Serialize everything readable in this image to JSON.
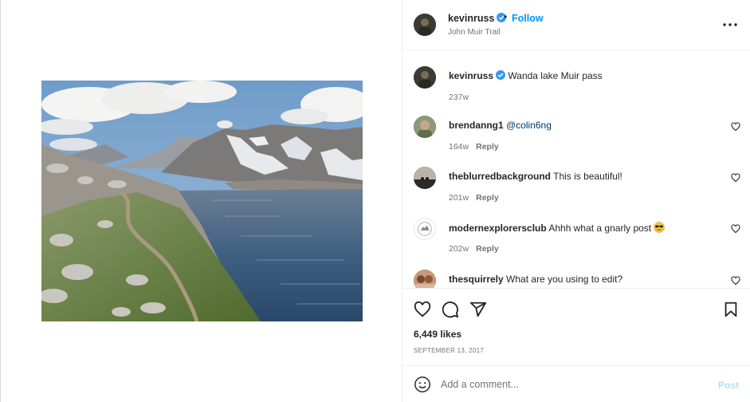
{
  "post": {
    "username": "kevinruss",
    "follow_label": "Follow",
    "separator": "•",
    "location": "John Muir Trail",
    "more_icon": "more-horizontal-icon"
  },
  "caption": {
    "username": "kevinruss",
    "text": "Wanda lake Muir pass",
    "age": "237w"
  },
  "comments": [
    {
      "username": "brendanng1",
      "text": "@colin6ng",
      "age": "164w",
      "reply_label": "Reply"
    },
    {
      "username": "theblurredbackground",
      "text": "This is beautiful!",
      "age": "201w",
      "reply_label": "Reply"
    },
    {
      "username": "modernexplorersclub",
      "text": "Ahhh what a gnarly post",
      "age": "202w",
      "reply_label": "Reply",
      "emoji": "sunglasses-emoji"
    },
    {
      "username": "thesquirrely",
      "text": "What are you using to edit?",
      "age": "",
      "reply_label": ""
    }
  ],
  "actions": {
    "likes": "6,449 likes",
    "date": "SEPTEMBER 13, 2017",
    "icons": [
      "heart-icon",
      "comment-icon",
      "share-icon",
      "bookmark-icon"
    ]
  },
  "add_comment": {
    "placeholder": "Add a comment...",
    "post_label": "Post"
  },
  "colors": {
    "accent": "#0095f6",
    "verified": "#3897f0",
    "post_disabled": "#b2dffc",
    "muted": "#737373"
  }
}
